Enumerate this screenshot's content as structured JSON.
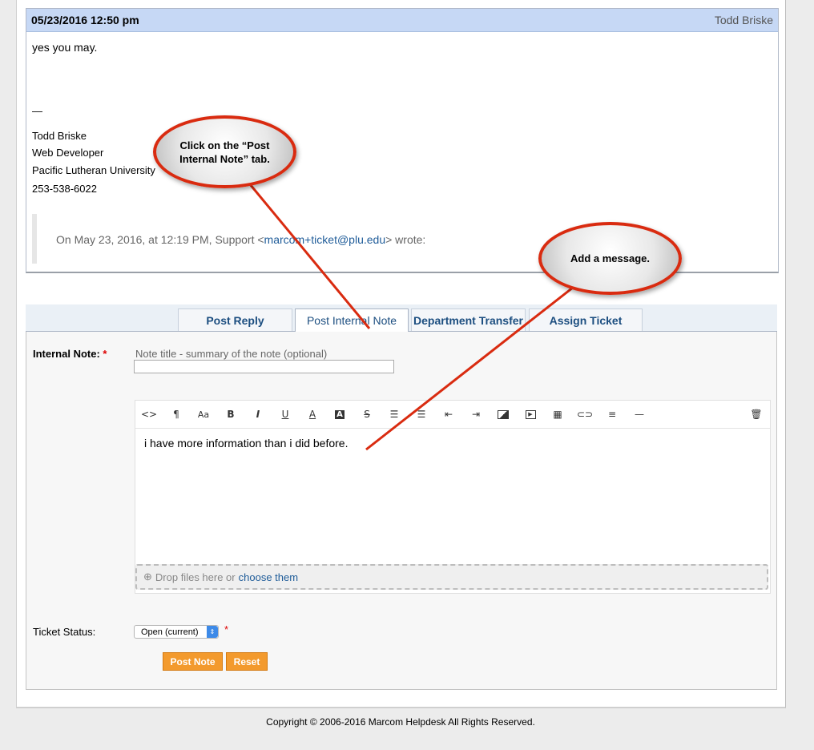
{
  "entry": {
    "date": "05/23/2016 12:50 pm",
    "author": "Todd Briske",
    "body_first": "yes you may.",
    "signature_dash": "—",
    "signature": [
      "Todd Briske",
      "Web Developer",
      "Pacific Lutheran University",
      "253-538-6022"
    ],
    "quote_prefix": "On May 23, 2016, at 12:19 PM, Support <",
    "quote_email": "marcom+ticket@plu.edu",
    "quote_suffix": "> wrote:"
  },
  "tabs": [
    {
      "label": "Post Reply",
      "active": false
    },
    {
      "label": "Post Internal Note",
      "active": true
    },
    {
      "label": "Department Transfer",
      "active": false
    },
    {
      "label": "Assign Ticket",
      "active": false
    }
  ],
  "form": {
    "internal_note_label": "Internal Note:",
    "required_mark": "*",
    "title_hint": "Note title - summary of the note (optional)",
    "title_value": "",
    "editor_text": "i have more information than i did before.",
    "dropzone_text": "Drop files here or",
    "dropzone_link": "choose them",
    "ticket_status_label": "Ticket Status:",
    "ticket_status_value": "Open (current)",
    "post_button": "Post Note",
    "reset_button": "Reset"
  },
  "toolbar_icons": [
    "code-view-icon",
    "paragraph-icon",
    "font-size-icon",
    "bold-icon",
    "italic-icon",
    "underline-icon",
    "font-color-icon",
    "background-color-icon",
    "strikethrough-icon",
    "unordered-list-icon",
    "ordered-list-icon",
    "outdent-icon",
    "indent-icon",
    "image-icon",
    "video-icon",
    "table-icon",
    "link-icon",
    "align-icon",
    "horizontal-rule-icon",
    "trash-icon"
  ],
  "callouts": {
    "tab_hint": "Click on the “Post Internal Note” tab.",
    "message_hint": "Add a message."
  },
  "footer": "Copyright © 2006-2016 Marcom Helpdesk All Rights Reserved.",
  "colors": {
    "header_bg": "#c6d8f5",
    "tab_text": "#1c4e80",
    "button_orange": "#f39a2d",
    "callout_border": "#d92b10"
  }
}
